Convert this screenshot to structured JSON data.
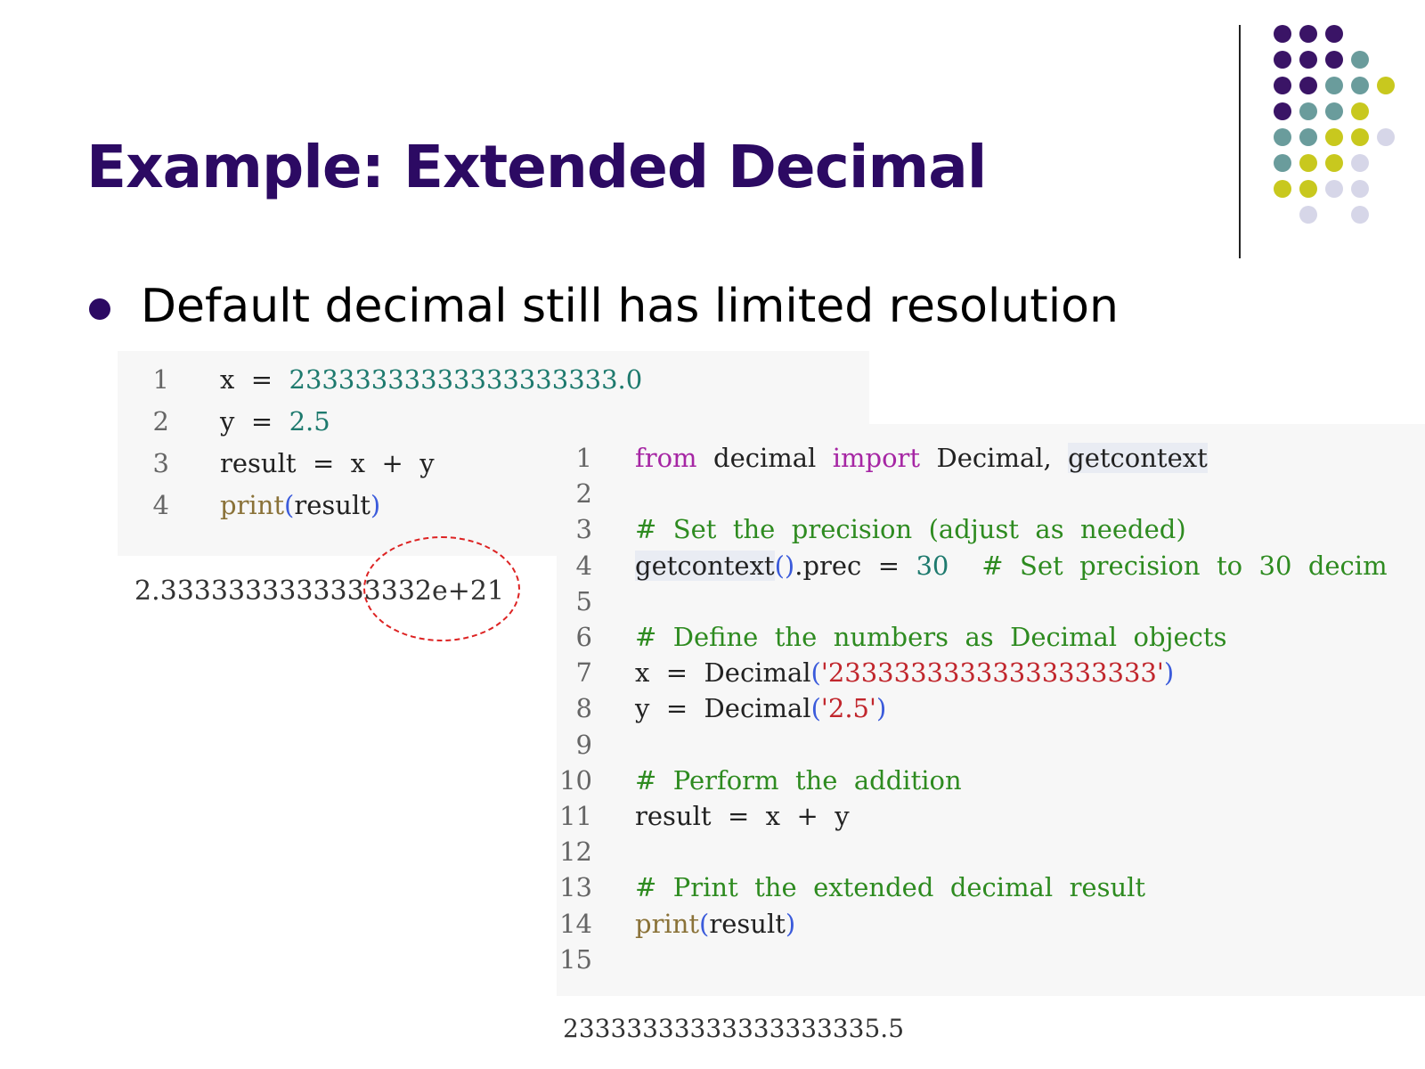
{
  "slide": {
    "title": "Example: Extended Decimal",
    "bullet": "Default decimal still has limited resolution"
  },
  "colors": {
    "title": "#2c0a63",
    "bullet_dot": "#2c0a63",
    "keyword": "#a626a4",
    "number": "#1e7a6e",
    "string": "#c1272d",
    "comment": "#2e8b20",
    "builtin": "#8a7238",
    "paren": "#3b5bdb",
    "highlight": "#e9ecf3",
    "dash_circle": "#dd2222",
    "dots": {
      "purple": "#3a1466",
      "teal": "#6a9c9c",
      "yellow": "#c8c81e",
      "lavender": "#d6d6e8"
    }
  },
  "dots": [
    [
      "purple",
      "purple",
      "purple",
      "",
      ""
    ],
    [
      "purple",
      "purple",
      "purple",
      "teal",
      ""
    ],
    [
      "purple",
      "purple",
      "teal",
      "teal",
      "yellow"
    ],
    [
      "purple",
      "teal",
      "teal",
      "yellow",
      ""
    ],
    [
      "teal",
      "teal",
      "yellow",
      "yellow",
      "lavender"
    ],
    [
      "teal",
      "yellow",
      "yellow",
      "lavender",
      ""
    ],
    [
      "yellow",
      "yellow",
      "lavender",
      "lavender",
      ""
    ],
    [
      "",
      "lavender",
      "",
      "lavender",
      ""
    ]
  ],
  "code_small": {
    "lines": [
      {
        "num": "1",
        "tokens": [
          {
            "t": "x"
          },
          {
            "t": "  =  "
          },
          {
            "t": "23333333333333333333.0",
            "c": "number"
          }
        ]
      },
      {
        "num": "2",
        "tokens": [
          {
            "t": "y"
          },
          {
            "t": "  =  "
          },
          {
            "t": "2.5",
            "c": "number"
          }
        ]
      },
      {
        "num": "3",
        "tokens": [
          {
            "t": "result  =  x  +  y"
          }
        ]
      },
      {
        "num": "4",
        "tokens": [
          {
            "t": "print",
            "c": "builtin"
          },
          {
            "t": "(",
            "c": "paren"
          },
          {
            "t": "result"
          },
          {
            "t": ")",
            "c": "paren"
          }
        ]
      }
    ]
  },
  "output_small": "2.3333333333333332e+21",
  "code_large": {
    "lines": [
      {
        "num": "1",
        "tokens": [
          {
            "t": "from",
            "c": "keyword"
          },
          {
            "t": "  decimal  "
          },
          {
            "t": "import",
            "c": "keyword"
          },
          {
            "t": "  Decimal,  "
          },
          {
            "t": "getcontext",
            "c": "highlight"
          }
        ]
      },
      {
        "num": "2",
        "tokens": []
      },
      {
        "num": "3",
        "tokens": [
          {
            "t": "#  Set  the  precision  (adjust  as  needed)",
            "c": "comment"
          }
        ]
      },
      {
        "num": "4",
        "tokens": [
          {
            "t": "getcontext",
            "c": "highlight"
          },
          {
            "t": "()",
            "c": "paren"
          },
          {
            "t": ".prec  =  "
          },
          {
            "t": "30",
            "c": "number"
          },
          {
            "t": "    "
          },
          {
            "t": "#  Set  precision  to  30  decim",
            "c": "comment"
          }
        ]
      },
      {
        "num": "5",
        "tokens": []
      },
      {
        "num": "6",
        "tokens": [
          {
            "t": "#  Define  the  numbers  as  Decimal  objects",
            "c": "comment"
          }
        ]
      },
      {
        "num": "7",
        "tokens": [
          {
            "t": "x  =  Decimal"
          },
          {
            "t": "(",
            "c": "paren"
          },
          {
            "t": "'23333333333333333333'",
            "c": "string"
          },
          {
            "t": ")",
            "c": "paren"
          }
        ]
      },
      {
        "num": "8",
        "tokens": [
          {
            "t": "y  =  Decimal"
          },
          {
            "t": "(",
            "c": "paren"
          },
          {
            "t": "'2.5'",
            "c": "string"
          },
          {
            "t": ")",
            "c": "paren"
          }
        ]
      },
      {
        "num": "9",
        "tokens": []
      },
      {
        "num": "10",
        "tokens": [
          {
            "t": "#  Perform  the  addition",
            "c": "comment"
          }
        ]
      },
      {
        "num": "11",
        "tokens": [
          {
            "t": "result  =  x  +  y"
          }
        ]
      },
      {
        "num": "12",
        "tokens": []
      },
      {
        "num": "13",
        "tokens": [
          {
            "t": "#  Print  the  extended  decimal  result",
            "c": "comment"
          }
        ]
      },
      {
        "num": "14",
        "tokens": [
          {
            "t": "print",
            "c": "builtin"
          },
          {
            "t": "(",
            "c": "paren"
          },
          {
            "t": "result"
          },
          {
            "t": ")",
            "c": "paren"
          }
        ]
      },
      {
        "num": "15",
        "tokens": []
      }
    ]
  },
  "output_large": "23333333333333333335.5"
}
